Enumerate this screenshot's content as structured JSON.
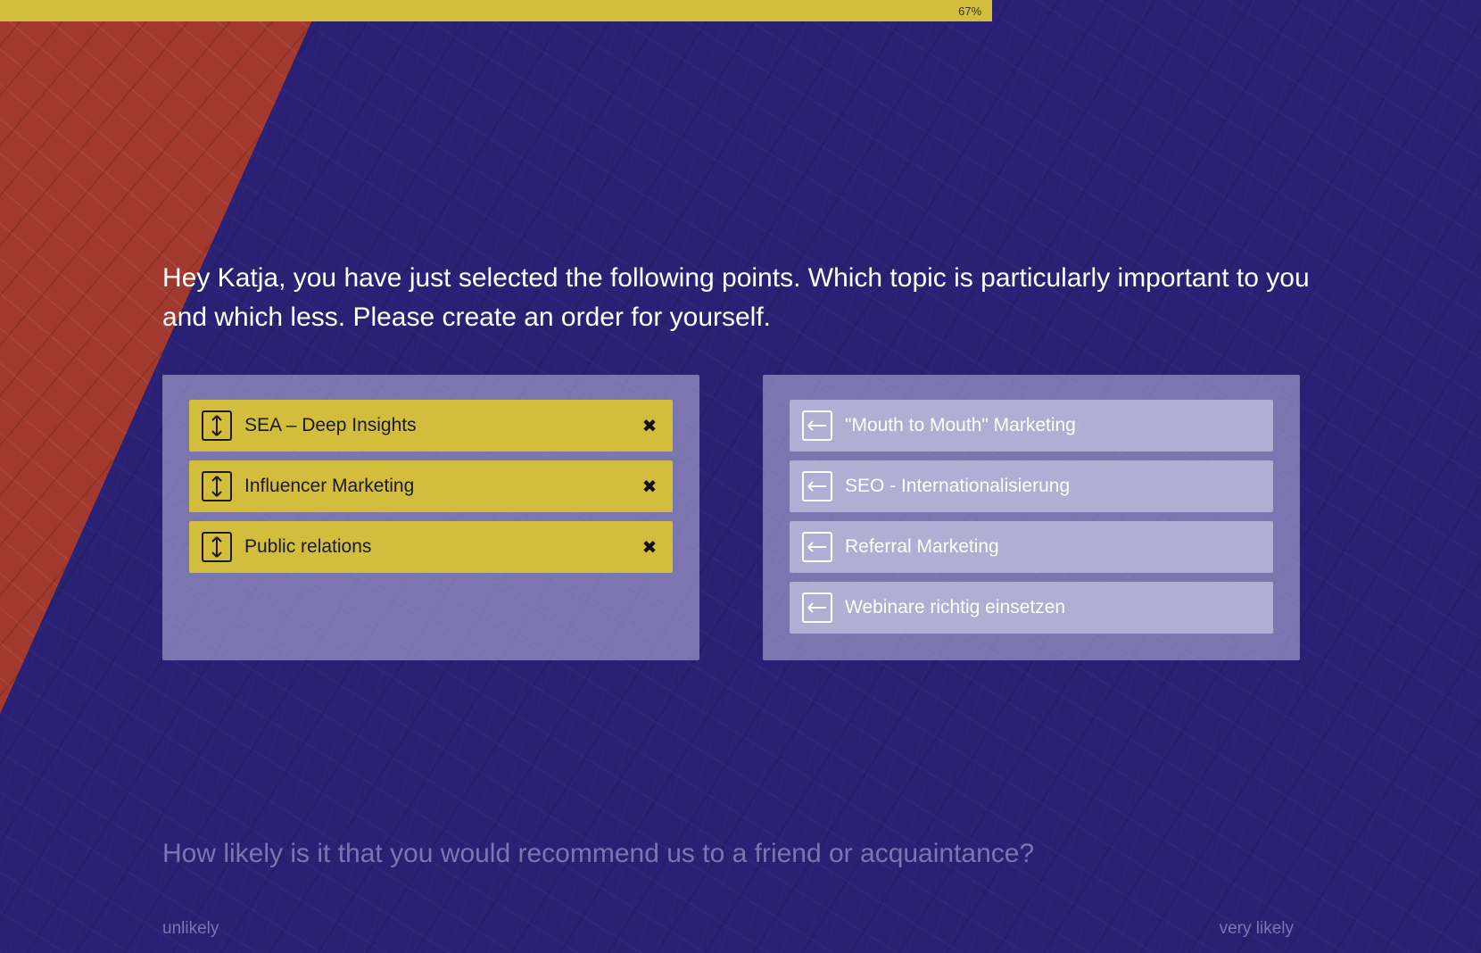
{
  "progress": {
    "percent": 67,
    "label": "67%"
  },
  "question": {
    "text": "Hey Katja, you have just selected the following points. Which topic is particularly important to you and which less. Please create an order for yourself."
  },
  "selected_items": [
    {
      "label": "SEA – Deep Insights"
    },
    {
      "label": "Influencer Marketing"
    },
    {
      "label": "Public relations"
    }
  ],
  "available_items": [
    {
      "label": "\"Mouth to Mouth\" Marketing"
    },
    {
      "label": "SEO - Internationalisierung"
    },
    {
      "label": "Referral Marketing"
    },
    {
      "label": "Webinare richtig einsetzen"
    }
  ],
  "next_question": {
    "text": "How likely is it that you would recommend us to a friend or acquaintance?",
    "scale_min_label": "unlikely",
    "scale_max_label": "very likely"
  },
  "icons": {
    "drag_handle": "updown-arrow-icon",
    "remove": "close-x-icon",
    "add": "left-arrow-icon"
  },
  "colors": {
    "accent": "#d3bd3c",
    "background": "#2a2174",
    "wedge": "#a2392f"
  }
}
